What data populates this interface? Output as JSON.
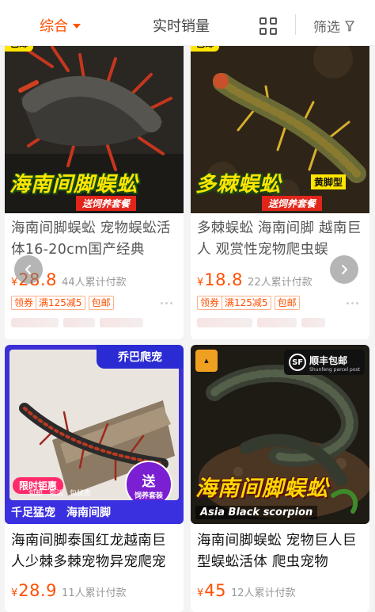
{
  "filter_bar": {
    "sort_label": "综合",
    "sales_label": "实时销量",
    "filter_label": "筛选"
  },
  "products": [
    {
      "title": "海南间脚蜈蚣 宠物蜈蚣活体16-20cm国产经典",
      "price_currency": "¥",
      "price": "28.8",
      "sold": "44人累计付款",
      "tags": {
        "coupon": "领券",
        "coupon_value": "满125减5",
        "shipping": "包邮"
      },
      "image": {
        "corner": "包邮",
        "banner_main": "海南间脚蜈蚣",
        "banner_sub": "送饲养套餐"
      }
    },
    {
      "title": "多棘蜈蚣 海南间脚 越南巨人 观赏性宠物爬虫蜈",
      "price_currency": "¥",
      "price": "18.8",
      "sold": "22人累计付款",
      "tags": {
        "coupon": "领券",
        "coupon_value": "满125减5",
        "shipping": "包邮"
      },
      "image": {
        "corner": "包邮",
        "banner_main": "多棘蜈蚣",
        "banner_note": "黄脚型",
        "banner_sub": "送饲养套餐"
      }
    },
    {
      "title": "海南间脚泰国红龙越南巨人少棘多棘宠物异宠爬宠",
      "price_currency": "¥",
      "price": "28.9",
      "sold": "11人累计付款",
      "image": {
        "top_label": "乔巴爬宠",
        "limited": "限时钜惠",
        "small_tags": [
          "包邮",
          "包活",
          "包状态"
        ],
        "send_big": "送",
        "send_small": "饲养套装",
        "bottom_left": "千足猛宠",
        "bottom_right": "海南间脚"
      }
    },
    {
      "title": "海南间脚蜈蚣 宠物巨人巨型蜈蚣活体 爬虫宠物",
      "price_currency": "¥",
      "price": "45",
      "sold": "12人累计付款",
      "image": {
        "sf_logo": "SF",
        "sf_text": "顺丰包邮",
        "sf_eng": "Shunfeng parcel post",
        "banner_main": "海南间脚蜈蚣",
        "banner_eng": "Asia Black scorpion"
      }
    }
  ],
  "icons": {
    "sort_caret": "caret-down-icon",
    "grid": "grid-view-icon",
    "filter": "funnel-icon",
    "prev": "chevron-left-icon",
    "next": "chevron-right-icon",
    "more": "more-dots-icon"
  },
  "colors": {
    "accent": "#ff5000",
    "price": "#ff5000",
    "muted": "#999999",
    "banner_yellow": "#ffe600",
    "banner_red": "#e1251b",
    "purple_banner": "#3a30e0"
  }
}
